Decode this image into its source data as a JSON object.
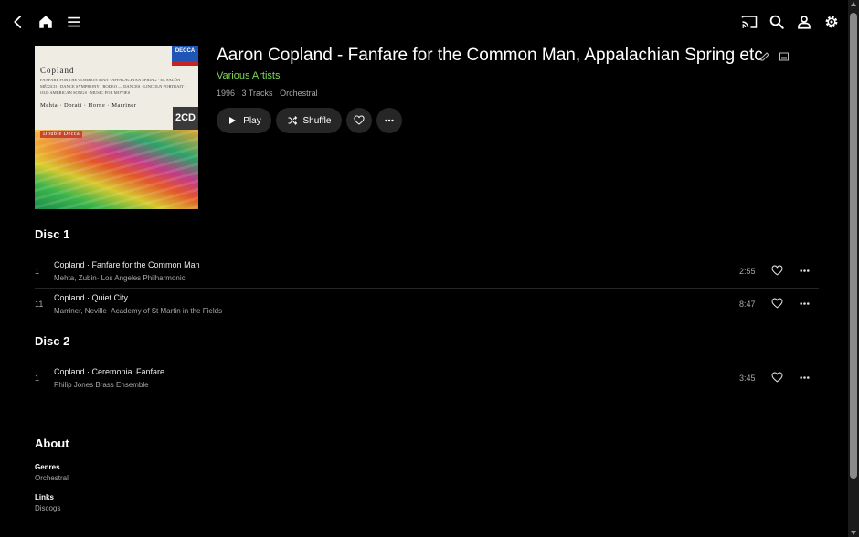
{
  "album": {
    "title": "Aaron Copland - Fanfare for the Common Man, Appalachian Spring etc",
    "artist": "Various Artists",
    "year": "1996",
    "track_count": "3 Tracks",
    "genre": "Orchestral"
  },
  "cover": {
    "label_brand": "DECCA",
    "composer": "Copland",
    "works": "Fanfare for the Common Man · Appalachian Spring · El Salón México · Dance Symphony · Rodeo — Dances · Lincoln Portrait · Old American Songs · Music for Movies",
    "performers": "Mehta · Dorati · Horne · Marriner",
    "disc_badge": "2CD",
    "series": "Double Decca"
  },
  "actions": {
    "play": "Play",
    "shuffle": "Shuffle"
  },
  "discs": [
    {
      "label": "Disc 1",
      "tracks": [
        {
          "number": "1",
          "title": "Copland · Fanfare for the Common Man",
          "artist": "Mehta, Zubin· Los Angeles Philharmonic",
          "duration": "2:55"
        },
        {
          "number": "11",
          "title": "Copland · Quiet City",
          "artist": "Marriner, Neville· Academy of St Martin in the Fields",
          "duration": "8:47"
        }
      ]
    },
    {
      "label": "Disc 2",
      "tracks": [
        {
          "number": "1",
          "title": "Copland · Ceremonial Fanfare",
          "artist": "Philip Jones Brass Ensemble",
          "duration": "3:45"
        }
      ]
    }
  ],
  "about": {
    "heading": "About",
    "genres_label": "Genres",
    "genres_value": "Orchestral",
    "links_label": "Links",
    "links_value": "Discogs"
  },
  "colors": {
    "background": "#000000",
    "accent_green": "#7ed957",
    "button_bg": "#262626"
  },
  "icons": {
    "topbar_left": [
      "back-icon",
      "home-icon",
      "menu-icon"
    ],
    "topbar_right": [
      "cast-icon",
      "search-icon",
      "user-icon",
      "settings-icon"
    ]
  }
}
